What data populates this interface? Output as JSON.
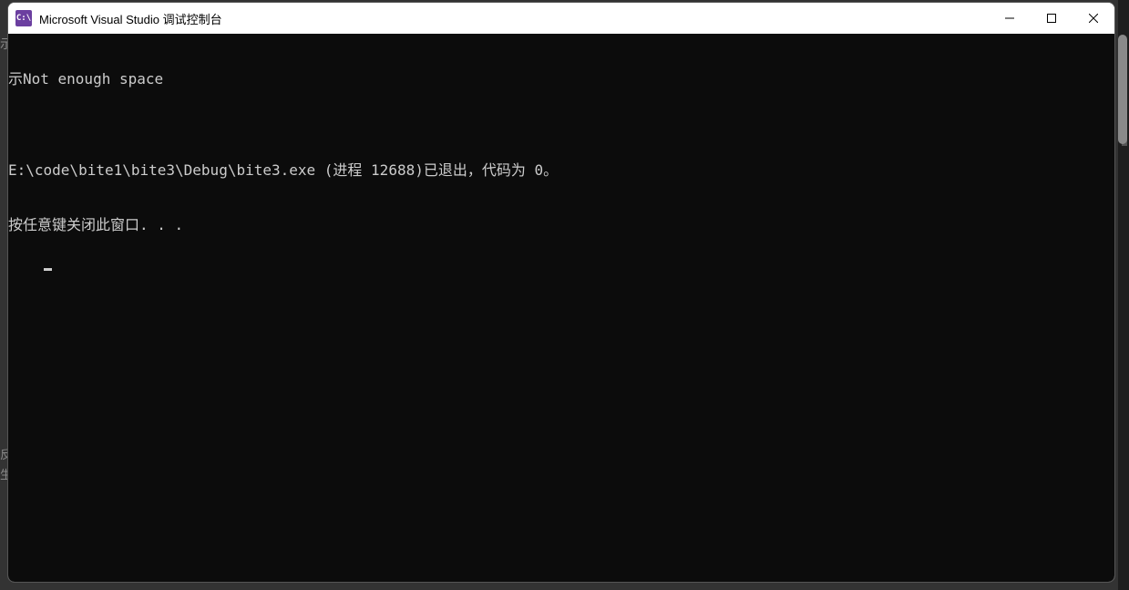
{
  "window": {
    "icon_label": "C:\\",
    "title": "Microsoft Visual Studio 调试控制台"
  },
  "console": {
    "lines": [
      "示Not enough space",
      "",
      "E:\\code\\bite1\\bite3\\Debug\\bite3.exe (进程 12688)已退出，代码为 0。",
      "按任意键关闭此窗口. . ."
    ]
  },
  "bg": {
    "left1": "反",
    "left2": "生"
  }
}
